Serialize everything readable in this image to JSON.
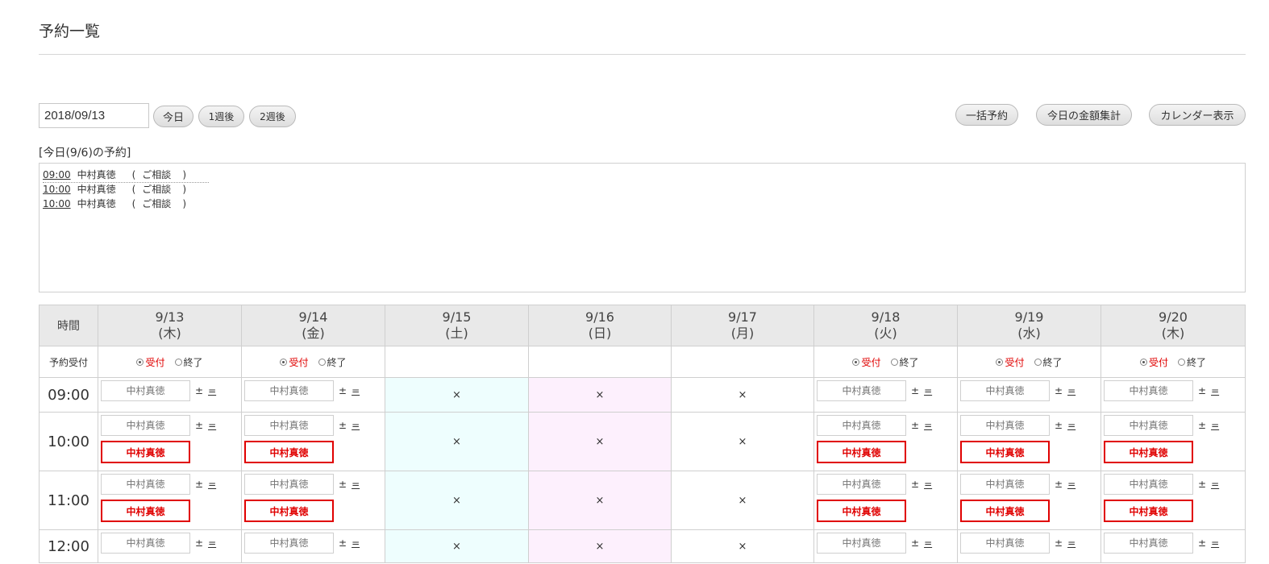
{
  "page_title": "予約一覧",
  "toolbar": {
    "date_value": "2018/09/13",
    "btn_today": "今日",
    "btn_1week": "1週後",
    "btn_2week": "2週後",
    "btn_bulk": "一括予約",
    "btn_totals": "今日の金額集計",
    "btn_calendar": "カレンダー表示"
  },
  "today": {
    "header": "[今日(9/6)の予約]",
    "items": [
      {
        "time": "09:00",
        "name": "中村真徳",
        "open": "(",
        "course": "ご相談",
        "close": ")"
      },
      {
        "time": "10:00",
        "name": "中村真徳",
        "open": "(",
        "course": "ご相談",
        "close": ")"
      },
      {
        "time": "10:00",
        "name": "中村真徳",
        "open": "(",
        "course": "ご相談",
        "close": ")"
      }
    ]
  },
  "schedule": {
    "time_header": "時間",
    "accept_label": "予約受付",
    "accept_option": "受付",
    "end_option": "終了",
    "closed_mark": "×",
    "slot_placeholder": "中村真徳",
    "plusminus": "±",
    "minus": "=",
    "days": [
      {
        "date": "9/13",
        "dow": "(木)",
        "open": true
      },
      {
        "date": "9/14",
        "dow": "(金)",
        "open": true
      },
      {
        "date": "9/15",
        "dow": "(土)",
        "open": false,
        "bg": "#eefefe"
      },
      {
        "date": "9/16",
        "dow": "(日)",
        "open": false,
        "bg": "#fdf0fd"
      },
      {
        "date": "9/17",
        "dow": "(月)",
        "open": false
      },
      {
        "date": "9/18",
        "dow": "(火)",
        "open": true
      },
      {
        "date": "9/19",
        "dow": "(水)",
        "open": true
      },
      {
        "date": "9/20",
        "dow": "(木)",
        "open": true
      }
    ],
    "rows": [
      {
        "time": "09:00",
        "booking": ""
      },
      {
        "time": "10:00",
        "booking": "中村真徳"
      },
      {
        "time": "11:00",
        "booking": "中村真徳"
      },
      {
        "time": "12:00",
        "booking": ""
      }
    ]
  },
  "colors": {
    "accent_red": "#e00000",
    "header_bg": "#e9e9e9",
    "saturday_bg": "#eefefe",
    "sunday_bg": "#fdf0fd"
  }
}
